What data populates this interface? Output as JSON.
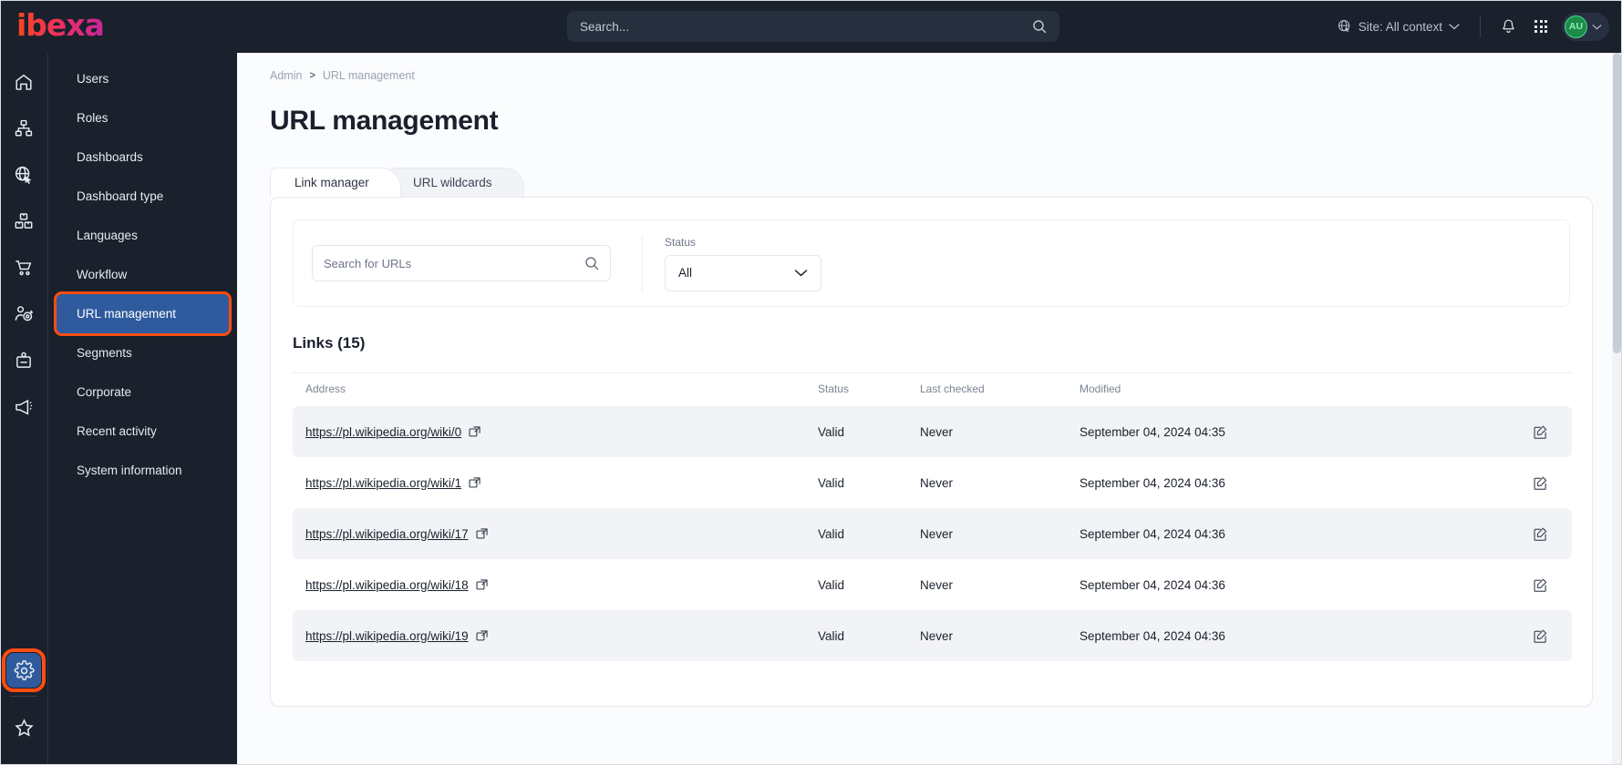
{
  "brand": {
    "logo_text": "ibexa",
    "logo_gradient_from": "#f7471e",
    "logo_gradient_to": "#c8259a"
  },
  "topbar": {
    "search_placeholder": "Search...",
    "site_context_label": "Site: All context",
    "avatar_initials": "AU",
    "avatar_color": "#4fd787"
  },
  "rail": {
    "items": [
      {
        "icon": "home-icon"
      },
      {
        "icon": "sitemap-icon"
      },
      {
        "icon": "globe-cursor-icon"
      },
      {
        "icon": "products-boxes-icon"
      },
      {
        "icon": "shopping-cart-icon"
      },
      {
        "icon": "customer-target-icon"
      },
      {
        "icon": "id-badge-icon"
      },
      {
        "icon": "megaphone-icon"
      }
    ],
    "bottom_items": [
      {
        "icon": "gear-icon",
        "active": true,
        "highlighted": true
      },
      {
        "icon": "star-icon",
        "active": false,
        "highlighted": false
      }
    ]
  },
  "sidebar": {
    "items": [
      {
        "label": "Users",
        "active": false
      },
      {
        "label": "Roles",
        "active": false
      },
      {
        "label": "Dashboards",
        "active": false
      },
      {
        "label": "Dashboard type",
        "active": false
      },
      {
        "label": "Languages",
        "active": false
      },
      {
        "label": "Workflow",
        "active": false
      },
      {
        "label": "URL management",
        "active": true
      },
      {
        "label": "Segments",
        "active": false
      },
      {
        "label": "Corporate",
        "active": false
      },
      {
        "label": "Recent activity",
        "active": false
      },
      {
        "label": "System information",
        "active": false
      }
    ]
  },
  "breadcrumb": {
    "root": "Admin",
    "separator": ">",
    "current": "URL management"
  },
  "page": {
    "title": "URL management"
  },
  "tabs": [
    {
      "label": "Link manager",
      "active": true
    },
    {
      "label": "URL wildcards",
      "active": false
    }
  ],
  "filters": {
    "search_placeholder": "Search for URLs",
    "status_label": "Status",
    "status_value": "All",
    "status_options": [
      "All"
    ]
  },
  "links_section": {
    "heading": "Links (15)",
    "columns": [
      "Address",
      "Status",
      "Last checked",
      "Modified"
    ],
    "rows": [
      {
        "address": "https://pl.wikipedia.org/wiki/0",
        "status": "Valid",
        "last_checked": "Never",
        "modified": "September 04, 2024 04:35"
      },
      {
        "address": "https://pl.wikipedia.org/wiki/1",
        "status": "Valid",
        "last_checked": "Never",
        "modified": "September 04, 2024 04:36"
      },
      {
        "address": "https://pl.wikipedia.org/wiki/17",
        "status": "Valid",
        "last_checked": "Never",
        "modified": "September 04, 2024 04:36"
      },
      {
        "address": "https://pl.wikipedia.org/wiki/18",
        "status": "Valid",
        "last_checked": "Never",
        "modified": "September 04, 2024 04:36"
      },
      {
        "address": "https://pl.wikipedia.org/wiki/19",
        "status": "Valid",
        "last_checked": "Never",
        "modified": "September 04, 2024 04:36"
      }
    ]
  },
  "annotation": {
    "color": "#ff4d11"
  }
}
